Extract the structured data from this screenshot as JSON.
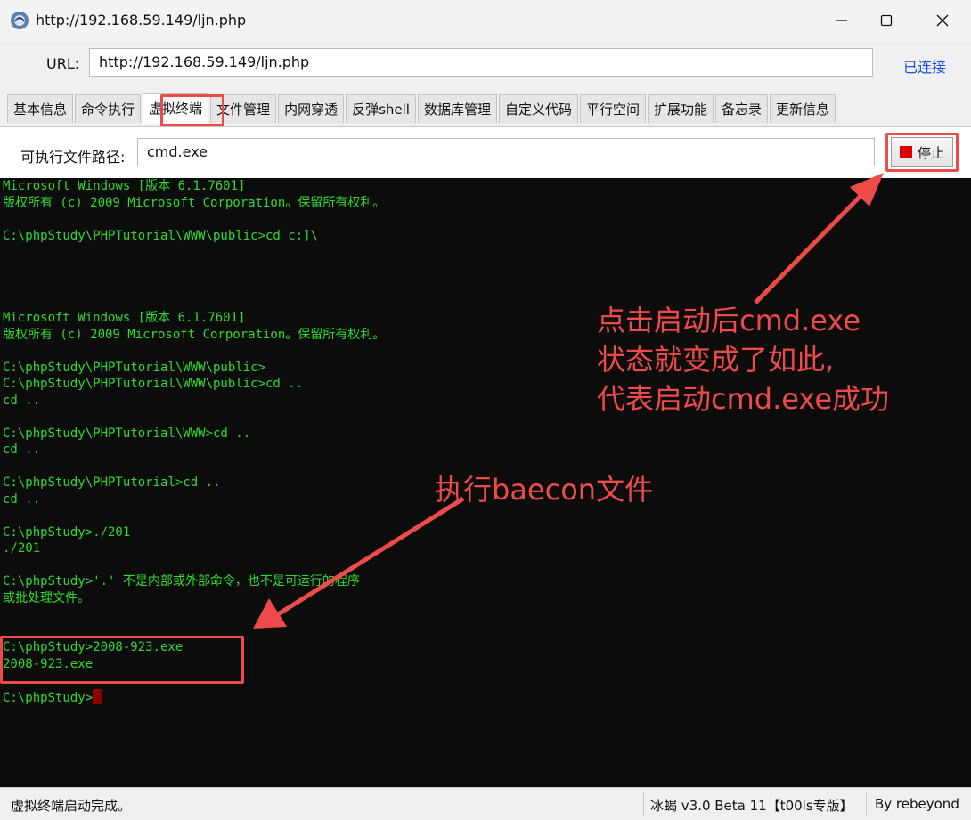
{
  "window": {
    "title": "http://192.168.59.149/ljn.php"
  },
  "urlbar": {
    "label": "URL:",
    "value": "http://192.168.59.149/ljn.php",
    "status": "已连接"
  },
  "tabs": [
    {
      "label": "基本信息"
    },
    {
      "label": "命令执行"
    },
    {
      "label": "虚拟终端",
      "active": true
    },
    {
      "label": "文件管理"
    },
    {
      "label": "内网穿透"
    },
    {
      "label": "反弹shell"
    },
    {
      "label": "数据库管理"
    },
    {
      "label": "自定义代码"
    },
    {
      "label": "平行空间"
    },
    {
      "label": "扩展功能"
    },
    {
      "label": "备忘录"
    },
    {
      "label": "更新信息"
    }
  ],
  "exec": {
    "label": "可执行文件路径:",
    "value": "cmd.exe",
    "stop_label": "停止"
  },
  "terminal": {
    "lines": [
      "Microsoft Windows [版本 6.1.7601]",
      "版权所有 (c) 2009 Microsoft Corporation。保留所有权利。",
      "",
      "C:\\phpStudy\\PHPTutorial\\WWW\\public>cd c:]\\",
      "",
      "",
      "",
      "",
      "Microsoft Windows [版本 6.1.7601]",
      "版权所有 (c) 2009 Microsoft Corporation。保留所有权利。",
      "",
      "C:\\phpStudy\\PHPTutorial\\WWW\\public>",
      "C:\\phpStudy\\PHPTutorial\\WWW\\public>cd ..",
      "cd ..",
      "",
      "C:\\phpStudy\\PHPTutorial\\WWW>cd ..",
      "cd ..",
      "",
      "C:\\phpStudy\\PHPTutorial>cd ..",
      "cd ..",
      "",
      "C:\\phpStudy>./201",
      "./201",
      "",
      "C:\\phpStudy>'.' 不是内部或外部命令，也不是可运行的程序",
      "或批处理文件。",
      "",
      "",
      "C:\\phpStudy>2008-923.exe",
      "2008-923.exe",
      "",
      "C:\\phpStudy>"
    ]
  },
  "annotations": {
    "note1": [
      "点击启动后cmd.exe",
      "状态就变成了如此,",
      "代表启动cmd.exe成功"
    ],
    "note2": "执行baecon文件"
  },
  "statusbar": {
    "left": "虚拟终端启动完成。",
    "mid": "冰蝎 v3.0 Beta 11【t00ls专版】",
    "right": "By rebeyond"
  },
  "colors": {
    "annotation": "#ef4a4a",
    "terminal_text": "#2edb2e",
    "terminal_bg": "#0c0c0c"
  }
}
